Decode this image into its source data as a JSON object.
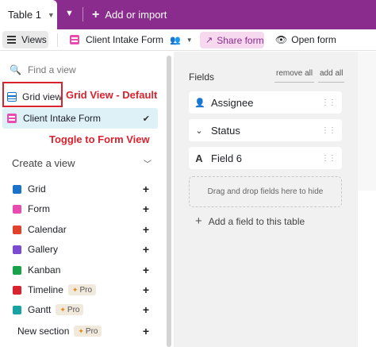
{
  "tabbar": {
    "active_tab": "Table 1",
    "add_label": "Add or import"
  },
  "toolbar": {
    "views_label": "Views",
    "form_name": "Client Intake Form",
    "share_label": "Share form",
    "open_label": "Open form"
  },
  "sidebar": {
    "find_placeholder": "Find a view",
    "views": [
      {
        "label": "Grid view",
        "icon": "grid-icon"
      },
      {
        "label": "Client Intake Form",
        "icon": "form-icon",
        "selected": true
      }
    ],
    "annotations": {
      "grid": "Grid View - Default",
      "form": "Toggle to Form View"
    },
    "create_heading": "Create a view",
    "create_items": [
      {
        "label": "Grid",
        "color": "#1a73c8"
      },
      {
        "label": "Form",
        "color": "#e84cb0"
      },
      {
        "label": "Calendar",
        "color": "#e2422b"
      },
      {
        "label": "Gallery",
        "color": "#7b4bd1"
      },
      {
        "label": "Kanban",
        "color": "#16a34a"
      },
      {
        "label": "Timeline",
        "color": "#d9232e",
        "badge": "Pro"
      },
      {
        "label": "Gantt",
        "color": "#1aa3a3",
        "badge": "Pro"
      },
      {
        "label": "New section",
        "badge": "Pro"
      }
    ]
  },
  "panel": {
    "title": "Fields",
    "remove_all": "remove all",
    "add_all": "add all",
    "fields": [
      {
        "label": "Assignee",
        "icon": "person-icon"
      },
      {
        "label": "Status",
        "icon": "chevron-circle-icon"
      },
      {
        "label": "Field 6",
        "icon": "text-field-icon"
      }
    ],
    "drop_hint": "Drag and drop fields here to hide",
    "add_field": "Add a field to this table"
  }
}
